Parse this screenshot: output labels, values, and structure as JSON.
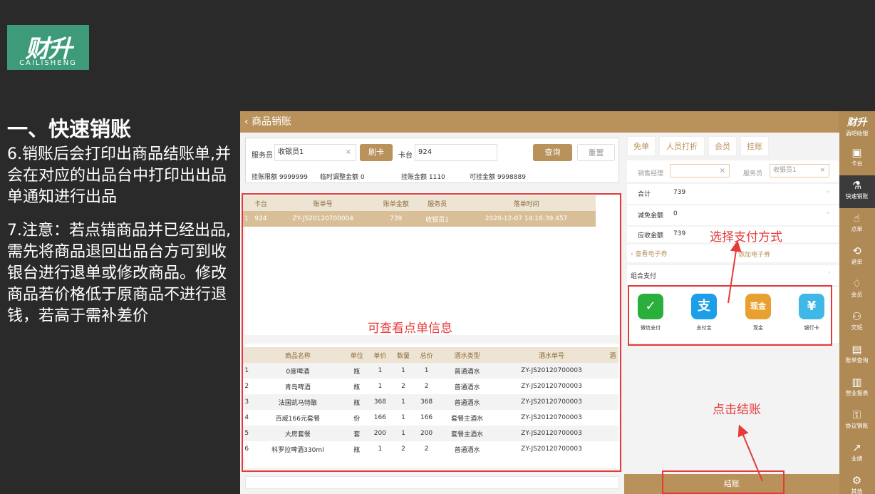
{
  "logo": {
    "main": "财升",
    "sub": "CAILISHENG"
  },
  "slide": {
    "heading": "一、快速销账",
    "note1": "6.销账后会打印出商品结账单,并会在对应的出品台中打印出出品单通知进行出品",
    "note2": "7.注意：若点错商品并已经出品,需先将商品退回出品台方可到收银台进行退单或修改商品。修改商品若价格低于原商品不进行退钱，若高于需补差价"
  },
  "app": {
    "title": "商品销账",
    "back_icon": "chevron-left-icon",
    "filter": {
      "waiter_label": "服务员",
      "waiter_value": "收银员1",
      "swipe_btn": "刷卡",
      "table_label": "卡台",
      "table_value": "924",
      "query_btn": "查询",
      "reset_btn": "重置",
      "credit_limit": "挂账限额 9999999",
      "temp_adjust": "临时调整金额 0",
      "credit_amount": "挂账金额 1110",
      "available_credit": "可挂金额 9998889"
    },
    "orders": {
      "headers": [
        "",
        "卡台",
        "账单号",
        "账单金额",
        "服务员",
        "落单时间"
      ],
      "rows": [
        [
          "1",
          "924",
          "ZY-JS20120700004",
          "739",
          "收银员1",
          "2020-12-07 14:16:39.457"
        ]
      ]
    },
    "items": {
      "headers": [
        "",
        "商品名称",
        "单位",
        "单价",
        "数量",
        "总价",
        "酒水类型",
        "酒水单号",
        "酒"
      ],
      "rows": [
        [
          "1",
          "0度啤酒",
          "瓶",
          "1",
          "1",
          "1",
          "普通酒水",
          "ZY-JS20120700003"
        ],
        [
          "2",
          "青岛啤酒",
          "瓶",
          "1",
          "2",
          "2",
          "普通酒水",
          "ZY-JS20120700003"
        ],
        [
          "3",
          "法国凯马特酿",
          "瓶",
          "368",
          "1",
          "368",
          "普通酒水",
          "ZY-JS20120700003"
        ],
        [
          "4",
          "百威166元套餐",
          "份",
          "166",
          "1",
          "166",
          "套餐主酒水",
          "ZY-JS20120700003"
        ],
        [
          "5",
          "大房套餐",
          "套",
          "200",
          "1",
          "200",
          "套餐主酒水",
          "ZY-JS20120700003"
        ],
        [
          "6",
          "科罗拉啤酒330ml",
          "瓶",
          "1",
          "2",
          "2",
          "普通酒水",
          "ZY-JS20120700003"
        ]
      ]
    },
    "tabs": [
      "免单",
      "人员打折",
      "会员",
      "挂账"
    ],
    "sales_manager_label": "销售经理",
    "waiter2_label": "服务员",
    "waiter2_value": "收银员1",
    "total_label": "合计",
    "total_value": "739",
    "discount_label": "减免金额",
    "discount_value": "0",
    "due_label": "应收金额",
    "due_value": "739",
    "view_coupon": "查看电子券",
    "add_coupon": "添加电子券",
    "combo_pay": "组合支付",
    "payments": [
      {
        "label": "微信支付",
        "icon": "wechat-pay-icon",
        "glyph": "✓",
        "color": "#2aae3c"
      },
      {
        "label": "支付宝",
        "icon": "alipay-icon",
        "glyph": "支",
        "color": "#1c9ee8"
      },
      {
        "label": "现金",
        "icon": "cash-icon",
        "glyph": "现金",
        "color": "#e8a030"
      },
      {
        "label": "银行卡",
        "icon": "bank-card-icon",
        "glyph": "¥",
        "color": "#3fb8e8"
      }
    ],
    "checkout_btn": "结账",
    "sidebar": {
      "brand": "财升",
      "brand_sub": "酒吧收银",
      "items": [
        {
          "label": "卡台",
          "icon": "table-icon",
          "glyph": "▣"
        },
        {
          "label": "快速销账",
          "icon": "quick-checkout-icon",
          "glyph": "⚗"
        },
        {
          "label": "点单",
          "icon": "order-hand-icon",
          "glyph": "☝"
        },
        {
          "label": "退单",
          "icon": "refund-icon",
          "glyph": "⟲"
        },
        {
          "label": "会员",
          "icon": "member-diamond-icon",
          "glyph": "♢"
        },
        {
          "label": "交班",
          "icon": "shift-users-icon",
          "glyph": "⚇"
        },
        {
          "label": "账单查询",
          "icon": "bill-search-icon",
          "glyph": "▤"
        },
        {
          "label": "营业报表",
          "icon": "report-icon",
          "glyph": "▥"
        },
        {
          "label": "协议销账",
          "icon": "agreement-icon",
          "glyph": "⚿"
        },
        {
          "label": "业绩",
          "icon": "performance-chart-icon",
          "glyph": "↗"
        },
        {
          "label": "其他",
          "icon": "settings-gear-icon",
          "glyph": "⚙"
        }
      ]
    }
  },
  "annotations": {
    "order_info": "可查看点单信息",
    "select_payment": "选择支付方式",
    "click_checkout": "点击结账",
    "color": "#e43a3a"
  }
}
